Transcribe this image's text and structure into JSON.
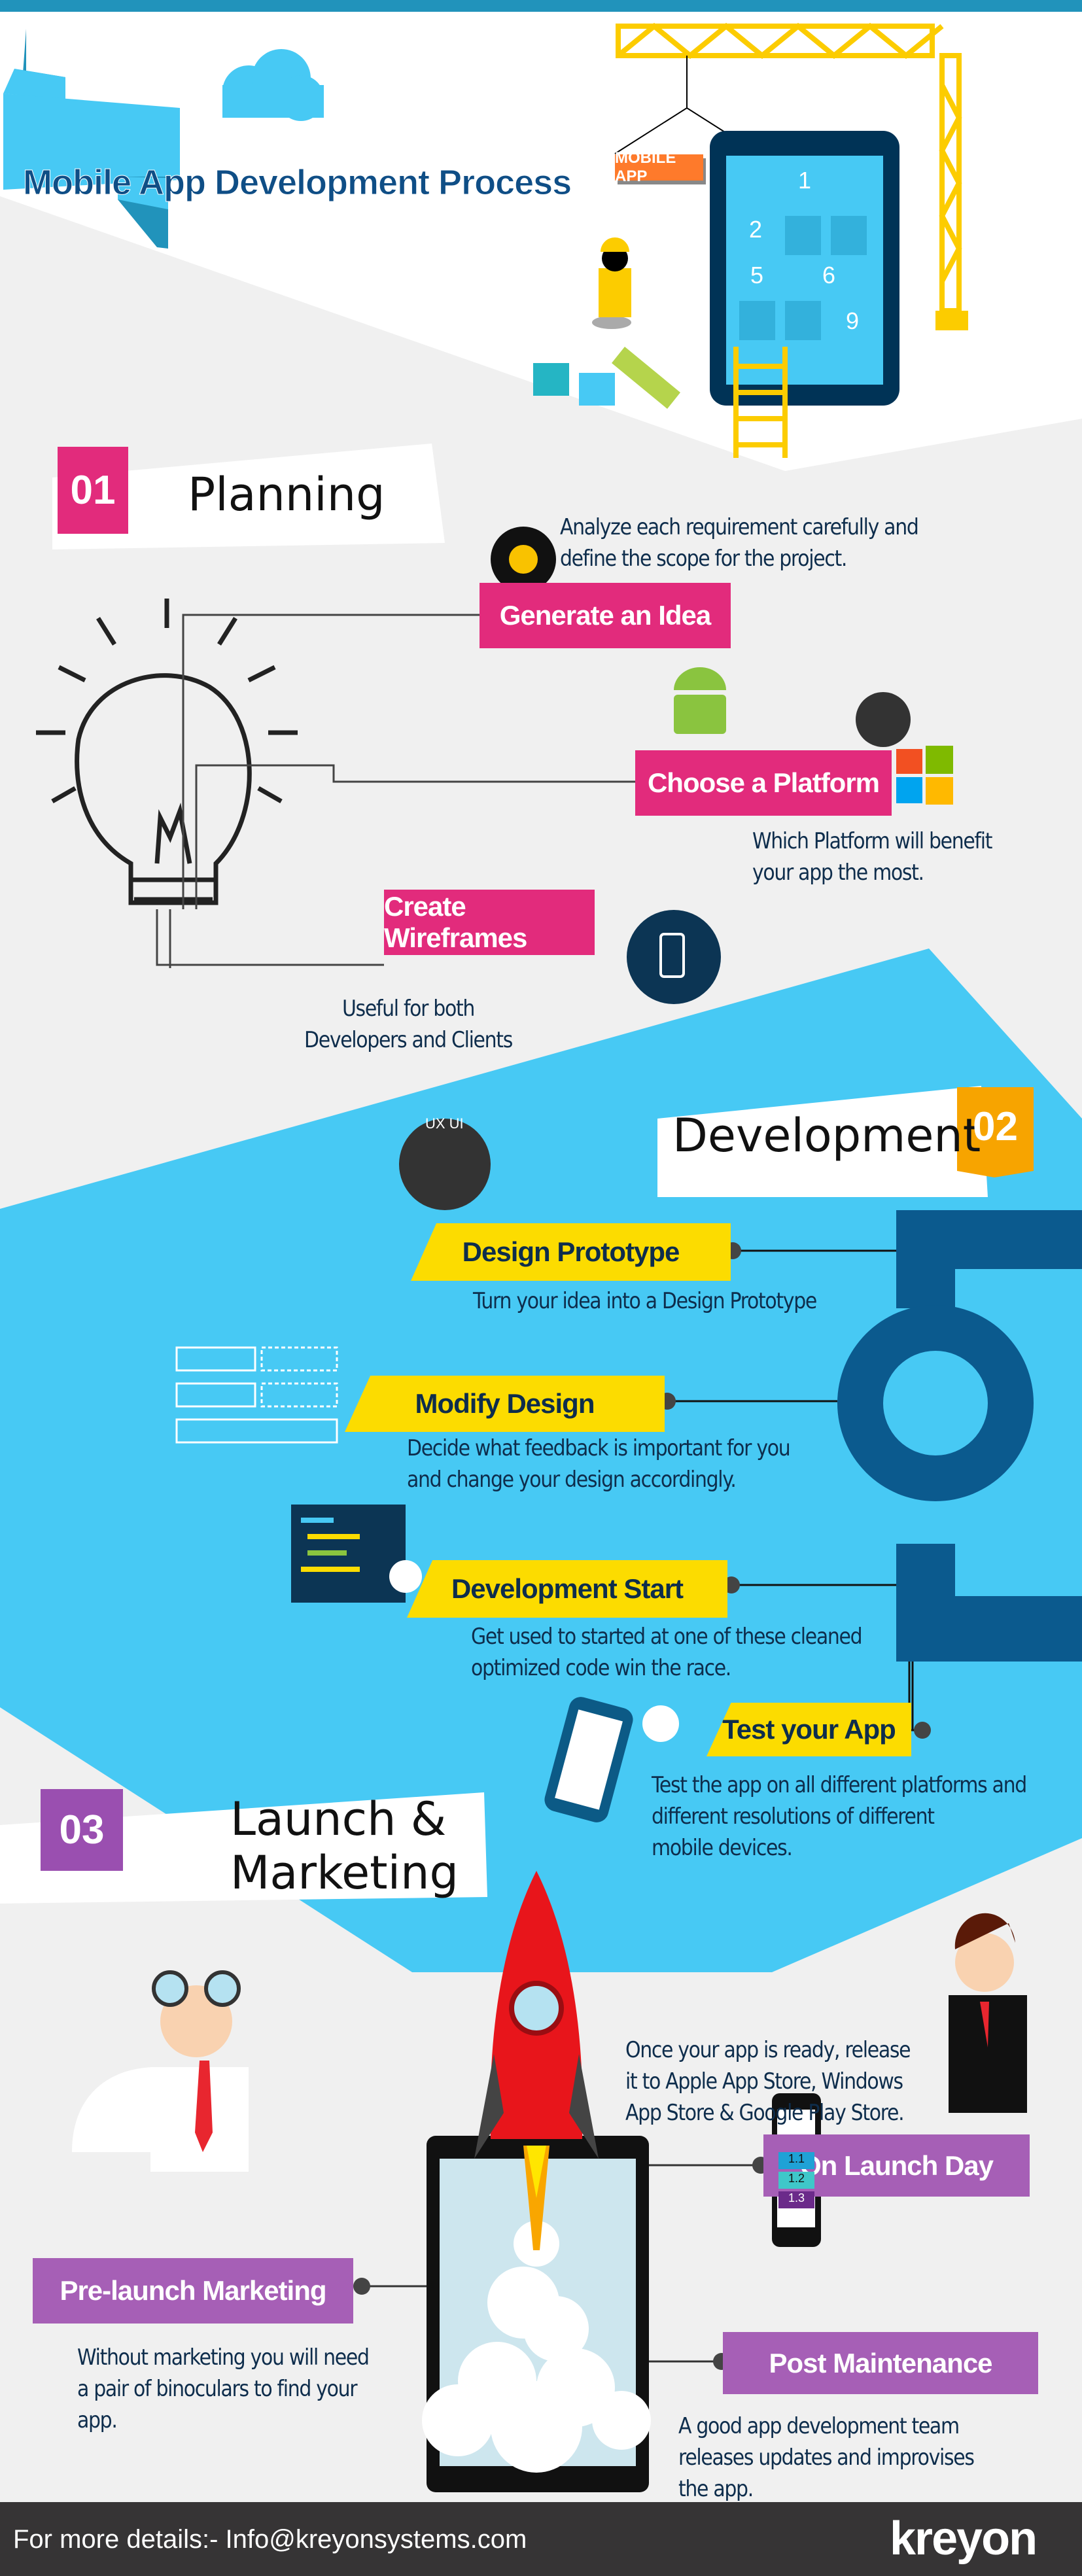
{
  "title": "Mobile App Development Process",
  "hero": {
    "sign": "MOBILE APP",
    "tiles": [
      "1",
      "2",
      "5",
      "6",
      "9"
    ]
  },
  "planning": {
    "number": "01",
    "heading": "Planning",
    "steps": [
      {
        "label": "Generate an Idea",
        "desc": [
          "Analyze each requirement carefully and",
          "define the scope for the project."
        ]
      },
      {
        "label": "Choose a Platform",
        "desc": [
          "Which Platform will benefit",
          "your app the most."
        ]
      },
      {
        "label": "Create Wireframes",
        "desc": [
          "Useful for both",
          "Developers and Clients"
        ]
      }
    ]
  },
  "development": {
    "number": "02",
    "heading": "Development",
    "ux_badge": "UX UI",
    "steps": [
      {
        "label": "Design Prototype",
        "desc": [
          "Turn your idea into a Design Prototype"
        ]
      },
      {
        "label": "Modify Design",
        "desc": [
          "Decide what feedback is important for you",
          "and change your design accordingly."
        ]
      },
      {
        "label": "Development Start",
        "desc": [
          "Get used to started at one of these cleaned",
          "optimized code win the race."
        ]
      },
      {
        "label": "Test your App",
        "desc": [
          "Test the app on all different platforms and",
          "different resolutions of different",
          "mobile devices."
        ]
      }
    ]
  },
  "launch": {
    "number": "03",
    "heading": [
      "Launch &",
      "Marketing"
    ],
    "steps": [
      {
        "label": "On Launch Day",
        "desc": [
          "Once your app is ready, release",
          "it to Apple App Store, Windows",
          "App Store & Google Play Store."
        ]
      },
      {
        "label": "Pre-launch Marketing",
        "desc": [
          "Without marketing you will need",
          "a pair of binoculars to find your",
          "app."
        ]
      },
      {
        "label": "Post Maintenance",
        "desc": [
          "A good app development team",
          "releases updates and improvises",
          "the app."
        ]
      }
    ],
    "phone_list": [
      "1.1",
      "1.2",
      "1.3"
    ]
  },
  "footer": {
    "contact": "For more details:- Info@kreyonsystems.com",
    "logo": "kreyon"
  },
  "colors": {
    "top_bar": "#2193bb",
    "blue": "#47c9f4",
    "pink": "#e22b7c",
    "yellow": "#fcdc00",
    "purple": "#a65fb6",
    "footer": "#363435",
    "text": "#0e2d4c"
  }
}
